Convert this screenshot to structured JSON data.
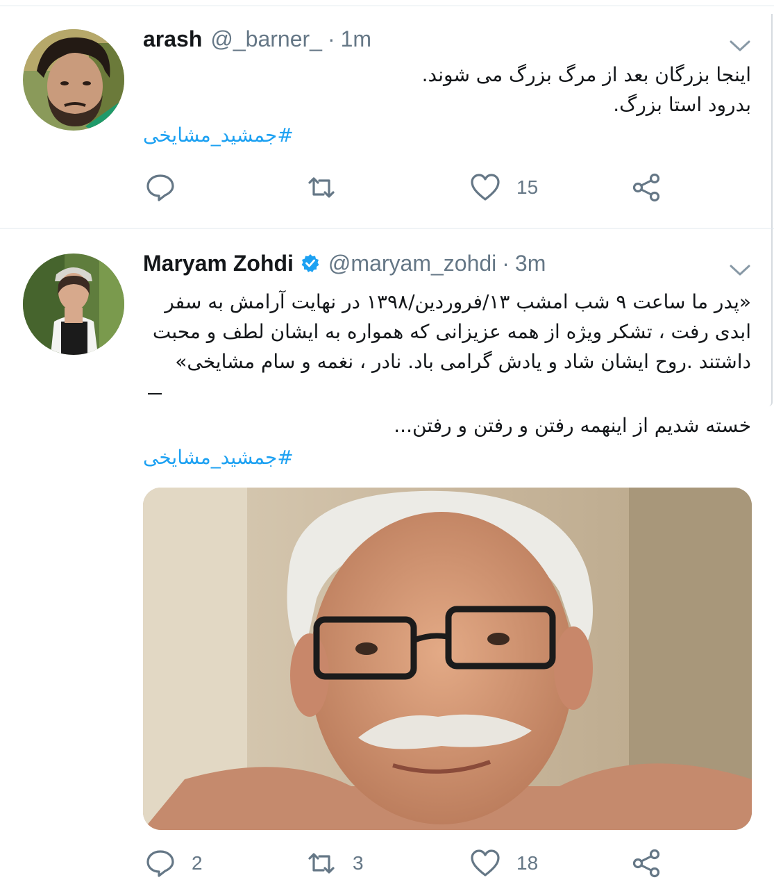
{
  "tweets": [
    {
      "name": "arash",
      "handle": "@_barner_",
      "separator": "·",
      "time": "1m",
      "text_lines": [
        "اینجا بزرگان بعد از مرگ بزرگ می شوند.",
        "بدرود استا بزرگ."
      ],
      "hashtag": "#جمشید_مشایخی",
      "actions": {
        "reply_count": "",
        "retweet_count": "",
        "like_count": "15"
      }
    },
    {
      "name": "Maryam Zohdi",
      "verified": true,
      "handle": "@maryam_zohdi",
      "separator": "·",
      "time": "3m",
      "text_lines": [
        "«پدر ما ساعت ۹ شب امشب ۱۳/فروردین/۱۳۹۸ در نهایت آرامش به سفر",
        "ابدی رفت ، تشکر ویژه از همه عزیزانی که همواره به ایشان لطف و محبت",
        "داشتند .روح ایشان شاد و یادش گرامی باد. نادر ، نغمه و سام مشایخی»"
      ],
      "text_after": "خسته شدیم از اینهمه رفتن و رفتن و رفتن...",
      "hashtag": "#جمشید_مشایخی",
      "actions": {
        "reply_count": "2",
        "retweet_count": "3",
        "like_count": "18"
      }
    }
  ],
  "colors": {
    "accent": "#1da1f2",
    "secondary_text": "#657786",
    "icon": "#657786",
    "divider": "#e1e8ed"
  },
  "icons": [
    "reply-icon",
    "retweet-icon",
    "like-icon",
    "share-icon",
    "chevron-down-icon",
    "verified-badge-icon"
  ]
}
